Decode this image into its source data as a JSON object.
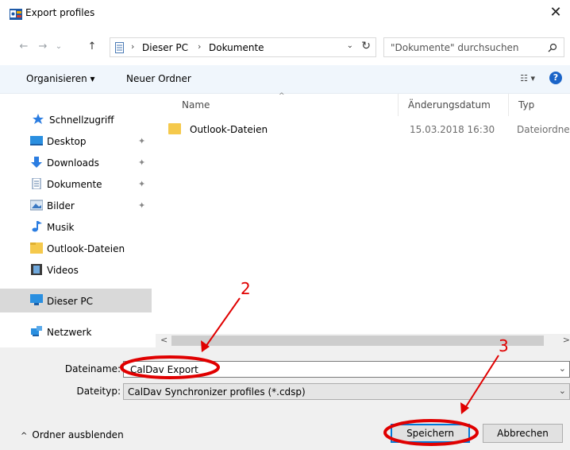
{
  "window": {
    "title": "Export profiles",
    "close_glyph": "✕"
  },
  "nav": {
    "back": "←",
    "forward": "→",
    "recent": "⌄",
    "up": "↑",
    "crumbs": [
      "Dieser PC",
      "Dokumente"
    ],
    "crumb_sep": "›",
    "refresh": "↻",
    "dropdown": "⌄"
  },
  "search": {
    "placeholder": "\"Dokumente\" durchsuchen",
    "icon": "search-icon"
  },
  "toolbar": {
    "organize_label": "Organisieren ▾",
    "new_folder_label": "Neuer Ordner",
    "view_glyph": "☷ ▾",
    "help_glyph": "?"
  },
  "sidebar": {
    "items": [
      {
        "label": "Schnellzugriff",
        "icon": "star-icon",
        "pin": ""
      },
      {
        "label": "Desktop",
        "icon": "desktop-icon",
        "pin": "📌"
      },
      {
        "label": "Downloads",
        "icon": "download-icon",
        "pin": "📌"
      },
      {
        "label": "Dokumente",
        "icon": "document-icon",
        "pin": "📌"
      },
      {
        "label": "Bilder",
        "icon": "pictures-icon",
        "pin": "📌"
      },
      {
        "label": "Musik",
        "icon": "music-icon",
        "pin": ""
      },
      {
        "label": "Outlook-Dateien",
        "icon": "folder-icon",
        "pin": ""
      },
      {
        "label": "Videos",
        "icon": "video-icon",
        "pin": ""
      },
      {
        "label": "Dieser PC",
        "icon": "computer-icon",
        "pin": ""
      },
      {
        "label": "Netzwerk",
        "icon": "network-icon",
        "pin": ""
      }
    ]
  },
  "list": {
    "columns": [
      "Name",
      "Änderungsdatum",
      "Typ"
    ],
    "sort_caret": "^",
    "rows": [
      {
        "name": "Outlook-Dateien",
        "date": "15.03.2018 16:30",
        "type": "Dateiordner"
      }
    ]
  },
  "scroll": {
    "left": "<",
    "right": ">"
  },
  "form": {
    "filename_label": "Dateiname:",
    "filename_value": "CalDav Export",
    "filetype_label": "Dateityp:",
    "filetype_value": "CalDav Synchronizer profiles (*.cdsp)",
    "dd_glyph": "⌄"
  },
  "footer": {
    "toggle_label": "Ordner ausblenden",
    "toggle_glyph": "^",
    "save_label": "Speichern",
    "cancel_label": "Abbrechen"
  },
  "annotations": {
    "step2": "2",
    "step3": "3",
    "color": "#e00000"
  }
}
